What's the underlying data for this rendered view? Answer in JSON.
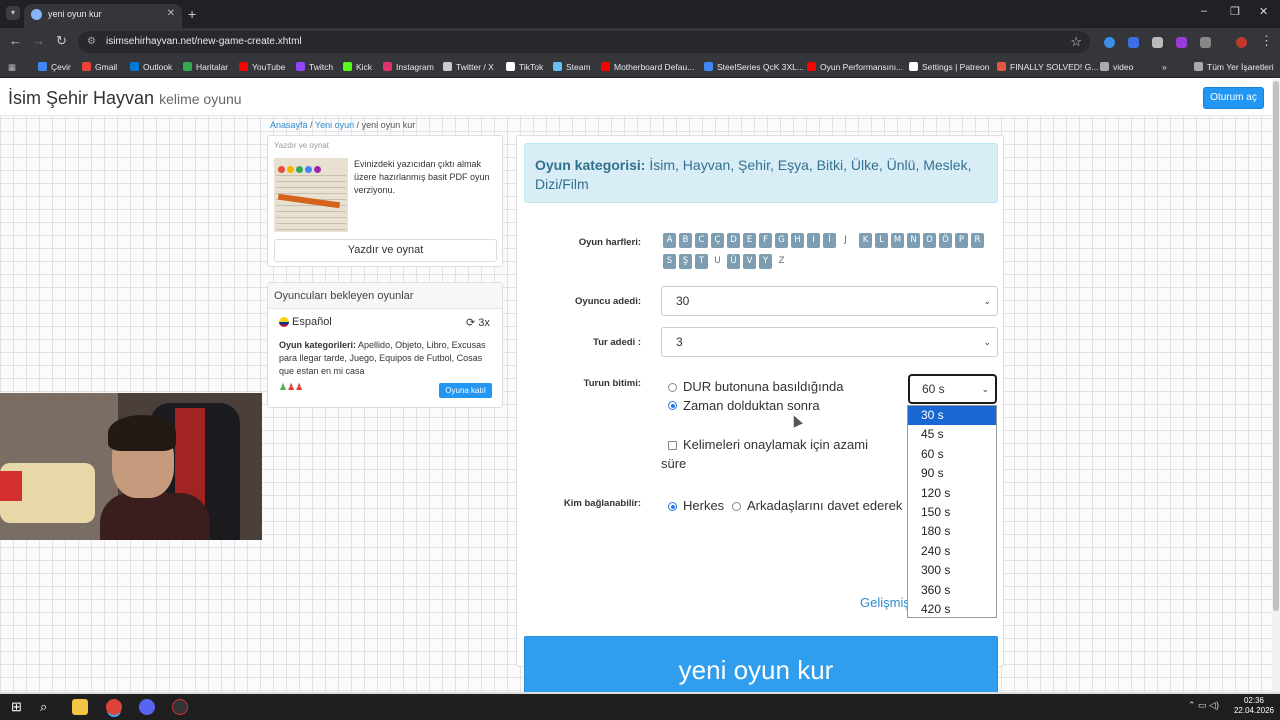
{
  "browser": {
    "tab_title": "yeni oyun kur",
    "new_tab_glyph": "+",
    "url": "isimsehirhayvan.net/new-game-create.xhtml",
    "bookmarks": [
      {
        "label": "Çevir",
        "color": "#4285f4"
      },
      {
        "label": "Gmail",
        "color": "#ea4335"
      },
      {
        "label": "Outlook",
        "color": "#0078d4"
      },
      {
        "label": "Haritalar",
        "color": "#34a853"
      },
      {
        "label": "YouTube",
        "color": "#ff0000"
      },
      {
        "label": "Twitch",
        "color": "#9146ff"
      },
      {
        "label": "Kick",
        "color": "#53fc18"
      },
      {
        "label": "Instagram",
        "color": "#e1306c"
      },
      {
        "label": "Twitter / X",
        "color": "#cccccc"
      },
      {
        "label": "TikTok",
        "color": "#ffffff"
      },
      {
        "label": "Steam",
        "color": "#66c0f4"
      },
      {
        "label": "Motherboard Defau...",
        "color": "#ff0000"
      },
      {
        "label": "SteelSeries QcK 3XL...",
        "color": "#4285f4"
      },
      {
        "label": "Oyun Performansını...",
        "color": "#ff0000"
      },
      {
        "label": "Settings | Patreon",
        "color": "#ffffff"
      },
      {
        "label": "FINALLY SOLVED! G...",
        "color": "#e2583e"
      },
      {
        "label": "video",
        "color": "#aaaaaa"
      }
    ],
    "more_glyph": "»",
    "all_bookmarks": "Tüm Yer İşaretleri"
  },
  "header": {
    "brand": "İsim Şehir Hayvan",
    "brand_sub": "kelime oyunu",
    "login_label": "Oturum aç"
  },
  "breadcrumb": {
    "home": "Anasayfa",
    "sep": "/",
    "new_game": "Yeni oyun",
    "current": "yeni oyun kur"
  },
  "print_panel": {
    "title": "Yazdır ve oynat",
    "description": "Evinizdeki yazıcıdan çıktı almak üzere hazırlanmış basit PDF oyun verziyonu.",
    "button_label": "Yazdır ve oynat"
  },
  "waiting_panel": {
    "title": "Oyuncuları bekleyen oyunlar",
    "language": "Español",
    "rounds": "3x",
    "categories_label": "Oyun kategorileri:",
    "categories": "Apellido, Objeto, Libro, Excusas para llegar tarde, Juego, Equipos de Futbol, Cosas que estan en mi casa",
    "join_label": "Oyuna katıl"
  },
  "form": {
    "category_label": "Oyun kategorisi:",
    "categories": "İsim, Hayvan, Şehir, Eşya, Bitki, Ülke, Ünlü, Meslek, Dizi/Film",
    "letters_label": "Oyun harfleri:",
    "letters": [
      {
        "ch": "A",
        "on": true
      },
      {
        "ch": "B",
        "on": true
      },
      {
        "ch": "C",
        "on": true
      },
      {
        "ch": "Ç",
        "on": true
      },
      {
        "ch": "D",
        "on": true
      },
      {
        "ch": "E",
        "on": true
      },
      {
        "ch": "F",
        "on": true
      },
      {
        "ch": "G",
        "on": true
      },
      {
        "ch": "H",
        "on": true
      },
      {
        "ch": "I",
        "on": true
      },
      {
        "ch": "İ",
        "on": true
      },
      {
        "ch": "J",
        "on": false
      },
      {
        "ch": "K",
        "on": true
      },
      {
        "ch": "L",
        "on": true
      },
      {
        "ch": "M",
        "on": true
      },
      {
        "ch": "N",
        "on": true
      },
      {
        "ch": "O",
        "on": true
      },
      {
        "ch": "Ö",
        "on": true
      },
      {
        "ch": "P",
        "on": true
      },
      {
        "ch": "R",
        "on": true
      },
      {
        "ch": "S",
        "on": true
      },
      {
        "ch": "Ş",
        "on": true
      },
      {
        "ch": "T",
        "on": true
      },
      {
        "ch": "U",
        "on": false
      },
      {
        "ch": "Ü",
        "on": true
      },
      {
        "ch": "V",
        "on": true
      },
      {
        "ch": "Y",
        "on": true
      },
      {
        "ch": "Z",
        "on": false
      }
    ],
    "players_label": "Oyuncu adedi:",
    "players_value": "30",
    "rounds_label": "Tur adedi :",
    "rounds_value": "3",
    "round_end_label": "Turun bitimi:",
    "round_end_opt1": "DUR butonuna basıldığında",
    "round_end_opt2": "Zaman dolduktan sonra",
    "round_end_selected": 2,
    "time_value": "60 s",
    "confirm_label_line1": "Kelimeleri onaylamak için azami",
    "confirm_label_line2": "süre",
    "join_label": "Kim bağlanabilir:",
    "join_opt1": "Herkes",
    "join_opt2": "Arkadaşlarını davet ederek",
    "advanced_link": "Gelişmiş",
    "create_button": "yeni oyun kur"
  },
  "time_dropdown": {
    "options": [
      "30 s",
      "45 s",
      "60 s",
      "90 s",
      "120 s",
      "150 s",
      "180 s",
      "240 s",
      "300 s",
      "360 s",
      "420 s"
    ],
    "highlighted": "30 s"
  },
  "taskbar": {
    "time": "02:36",
    "date": "22.04.2026"
  },
  "colors": {
    "primary": "#2196f3",
    "info_bg": "#d9edf7",
    "info_text": "#31708f",
    "letter_bg": "#7d9eb1",
    "highlight": "#1967d2"
  }
}
